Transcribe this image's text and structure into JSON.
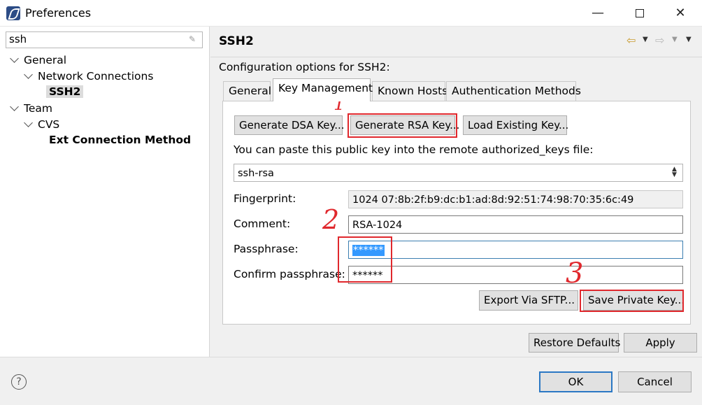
{
  "window": {
    "title": "Preferences",
    "minimize": "—",
    "close": "✕"
  },
  "sidebar": {
    "filter_value": "ssh",
    "tree": [
      {
        "label": "General"
      },
      {
        "label": "Network Connections"
      },
      {
        "label": "SSH2"
      },
      {
        "label": "Team"
      },
      {
        "label": "CVS"
      },
      {
        "label": "Ext Connection Method"
      }
    ]
  },
  "page": {
    "title": "SSH2",
    "description": "Configuration options for SSH2:",
    "nav": {
      "back": "⇦",
      "forward": "⇨",
      "drop": "▼"
    }
  },
  "tabs": [
    {
      "label": "General"
    },
    {
      "label": "Key Management"
    },
    {
      "label": "Known Hosts"
    },
    {
      "label": "Authentication Methods"
    }
  ],
  "key_management": {
    "gen_dsa": "Generate DSA Key...",
    "gen_rsa": "Generate RSA Key...",
    "load_key": "Load Existing Key...",
    "paste_hint": "You can paste this public key into the remote authorized_keys file:",
    "public_key": "ssh-rsa",
    "fingerprint_label": "Fingerprint:",
    "fingerprint_value": "1024 07:8b:2f:b9:dc:b1:ad:8d:92:51:74:98:70:35:6c:49",
    "comment_label": "Comment:",
    "comment_value": "RSA-1024",
    "passphrase_label": "Passphrase:",
    "passphrase_value": "******",
    "confirm_label": "Confirm passphrase:",
    "confirm_value": "******",
    "export_sftp": "Export Via SFTP...",
    "save_private": "Save Private Key..."
  },
  "footer": {
    "restore_defaults": "Restore Defaults",
    "apply": "Apply",
    "ok": "OK",
    "cancel": "Cancel",
    "help": "?"
  },
  "annotations": {
    "mark1": "1",
    "mark2": "2",
    "mark3": "3"
  },
  "colors": {
    "annotation_red": "#e0282d",
    "selection_blue": "#3399ff",
    "focus_blue": "#2b78c4"
  }
}
